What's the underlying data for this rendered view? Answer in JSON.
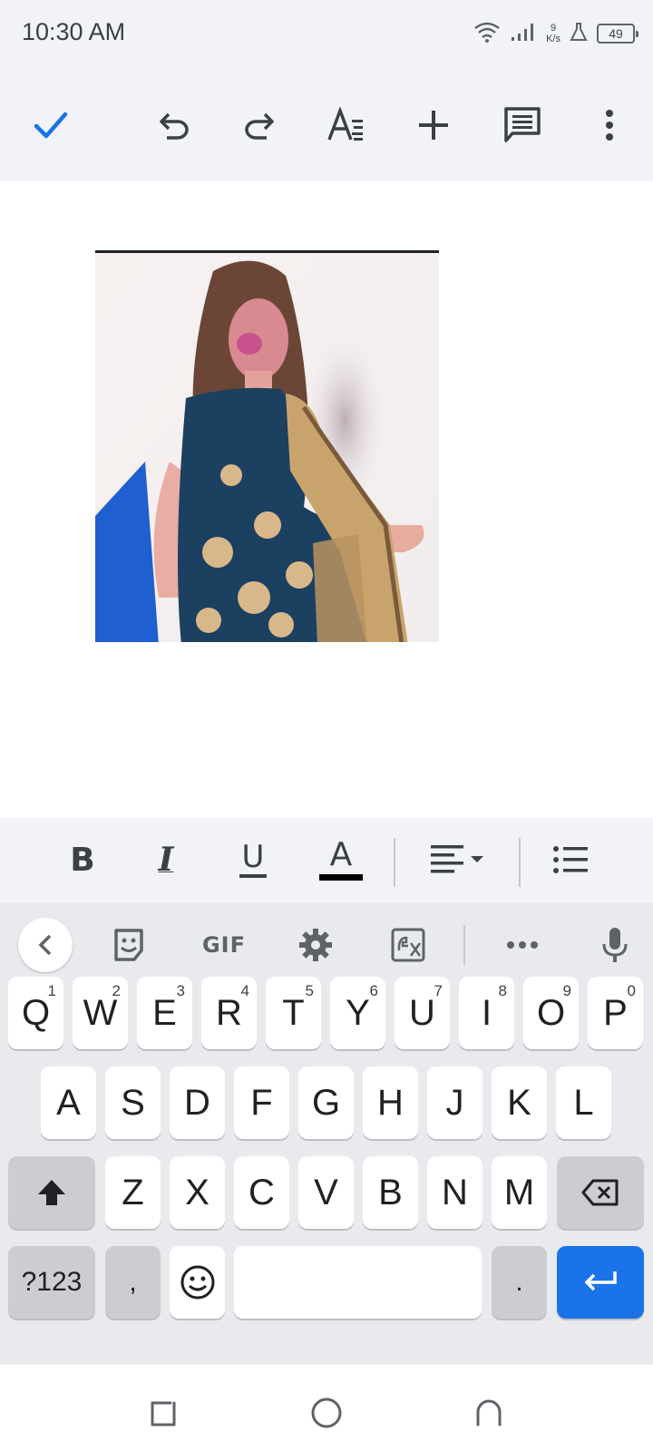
{
  "status_bar": {
    "time": "10:30 AM",
    "net_speed_value": "9",
    "net_speed_unit": "K/s",
    "battery": "49"
  },
  "toolbar": {
    "icons": [
      "check-icon",
      "undo-icon",
      "redo-icon",
      "text-format-icon",
      "add-icon",
      "comment-icon",
      "more-vert-icon"
    ],
    "accent_color": "#1a73e8"
  },
  "document": {
    "image_description_icon": "photo-image"
  },
  "format_bar": {
    "bold": "B",
    "italic": "I",
    "underline": "U",
    "text_color": "A"
  },
  "keyboard": {
    "row1": [
      {
        "label": "Q",
        "hint": "1"
      },
      {
        "label": "W",
        "hint": "2"
      },
      {
        "label": "E",
        "hint": "3"
      },
      {
        "label": "R",
        "hint": "4"
      },
      {
        "label": "T",
        "hint": "5"
      },
      {
        "label": "Y",
        "hint": "6"
      },
      {
        "label": "U",
        "hint": "7"
      },
      {
        "label": "I",
        "hint": "8"
      },
      {
        "label": "O",
        "hint": "9"
      },
      {
        "label": "P",
        "hint": "0"
      }
    ],
    "row2": [
      "A",
      "S",
      "D",
      "F",
      "G",
      "H",
      "J",
      "K",
      "L"
    ],
    "row3": [
      "Z",
      "X",
      "C",
      "V",
      "B",
      "N",
      "M"
    ],
    "symbols_label": "?123",
    "comma": ",",
    "period": ".",
    "suggestion_gif": "GIF",
    "enter_color": "#1a73e8"
  }
}
